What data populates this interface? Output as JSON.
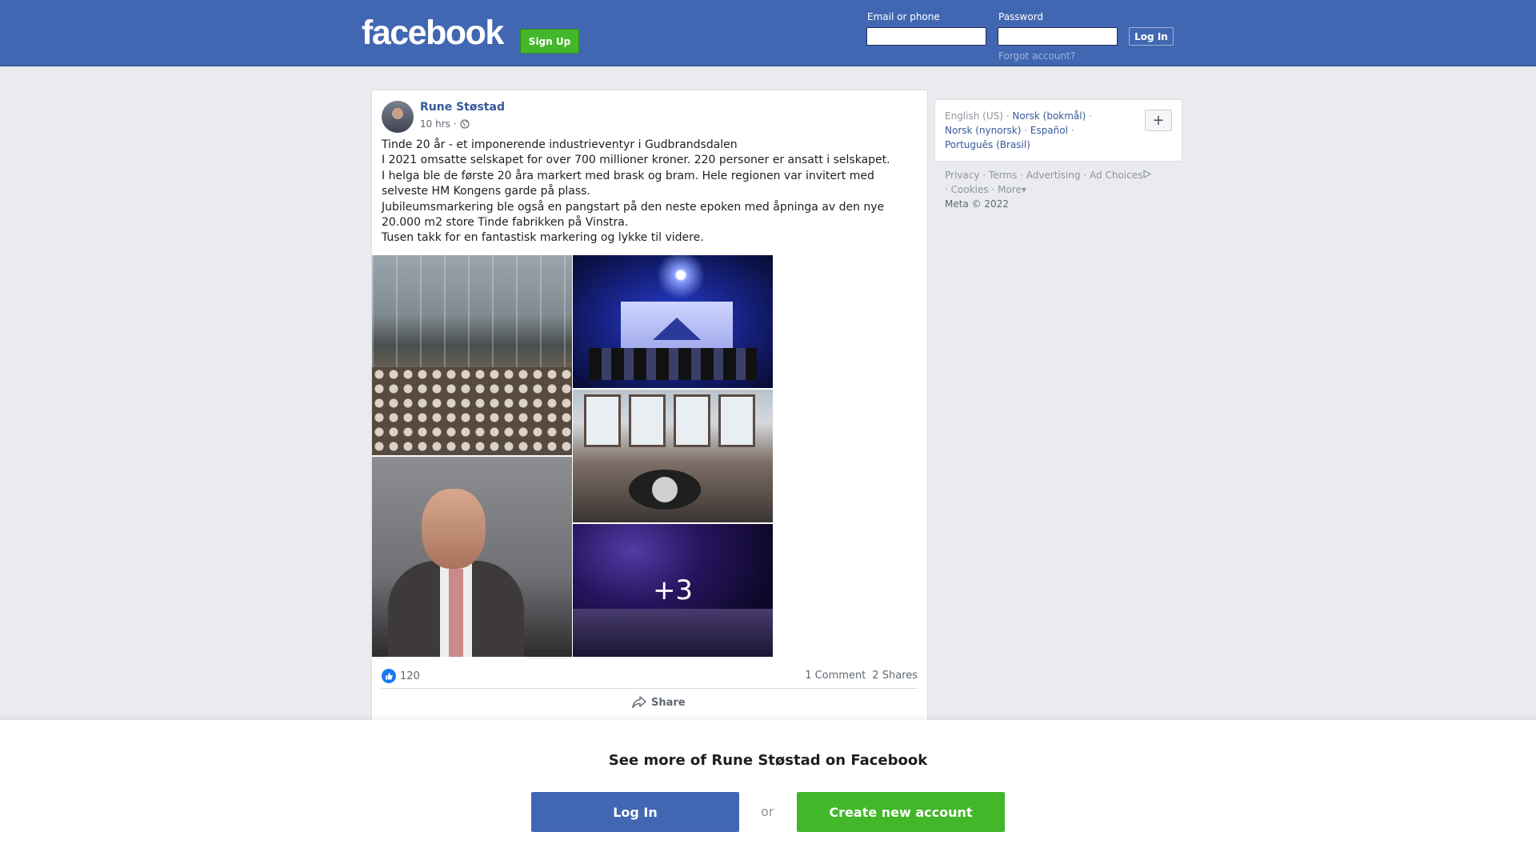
{
  "header": {
    "logo": "facebook",
    "signup_label": "Sign Up",
    "email_label": "Email or phone",
    "email_value": "",
    "password_label": "Password",
    "password_value": "",
    "login_label": "Log In",
    "forgot_label": "Forgot account?"
  },
  "post": {
    "author": "Rune Støstad",
    "time": "10 hrs ·",
    "privacy_icon": "globe-icon",
    "text": [
      "Tinde 20 år - et imponerende industrieventyr i Gudbrandsdalen",
      "I 2021 omsatte selskapet for over 700 millioner kroner. 220 personer er ansatt i selskapet.",
      "I helga ble de første 20 åra markert med brask og bram. Hele regionen var invitert med selveste HM Kongens garde på plass.",
      "Jubileumsmarkering ble også en pangstart på den neste epoken med åpninga av den nye 20.000 m2 store Tinde fabrikken på Vinstra.",
      "Tusen takk for en fantastisk markering og lykke til videre."
    ],
    "photos_more": "+3",
    "likes": "120",
    "comments": "1 Comment",
    "shares": "2 Shares",
    "share_label": "Share"
  },
  "sidebar": {
    "languages": {
      "current": "English (US)",
      "links": [
        "Norsk (bokmål)",
        "Norsk (nynorsk)",
        "Español",
        "Português (Brasil)"
      ]
    },
    "more_languages_icon": "plus-icon",
    "footer_links": [
      "Privacy",
      "Terms",
      "Advertising",
      "Ad Choices",
      "Cookies",
      "More"
    ],
    "copyright": "Meta © 2022"
  },
  "banner": {
    "title": "See more of Rune Støstad on Facebook",
    "login_label": "Log In",
    "or_label": "or",
    "create_label": "Create new account"
  },
  "colors": {
    "brand_blue": "#4267b2",
    "green": "#42b72a",
    "link": "#385898"
  }
}
